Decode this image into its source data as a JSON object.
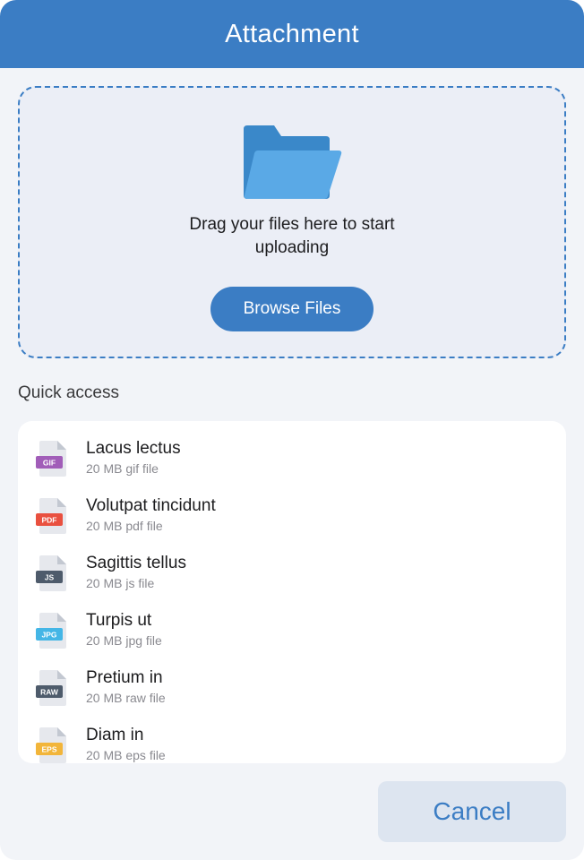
{
  "dialog": {
    "title": "Attachment"
  },
  "dropzone": {
    "icon": "folder-icon",
    "text": "Drag your files here to start uploading",
    "browse_label": "Browse Files"
  },
  "quick_access": {
    "title": "Quick access",
    "files": [
      {
        "name": "Lacus lectus",
        "meta": "20 MB gif file",
        "ext": "GIF",
        "color": "#a15db8"
      },
      {
        "name": "Volutpat tincidunt",
        "meta": "20 MB pdf file",
        "ext": "PDF",
        "color": "#e9503f"
      },
      {
        "name": "Sagittis tellus",
        "meta": "20 MB js file",
        "ext": "JS",
        "color": "#4e5b6b"
      },
      {
        "name": "Turpis ut",
        "meta": "20 MB jpg file",
        "ext": "JPG",
        "color": "#44b6e6"
      },
      {
        "name": "Pretium in",
        "meta": "20 MB raw file",
        "ext": "RAW",
        "color": "#4e5b6b"
      },
      {
        "name": "Diam in",
        "meta": "20 MB eps file",
        "ext": "EPS",
        "color": "#f2b53a"
      }
    ]
  },
  "footer": {
    "cancel_label": "Cancel"
  },
  "colors": {
    "accent": "#3b7dc4",
    "background": "#f2f4f8",
    "folder_back": "#3a88c9",
    "folder_front": "#5aa9e6"
  }
}
